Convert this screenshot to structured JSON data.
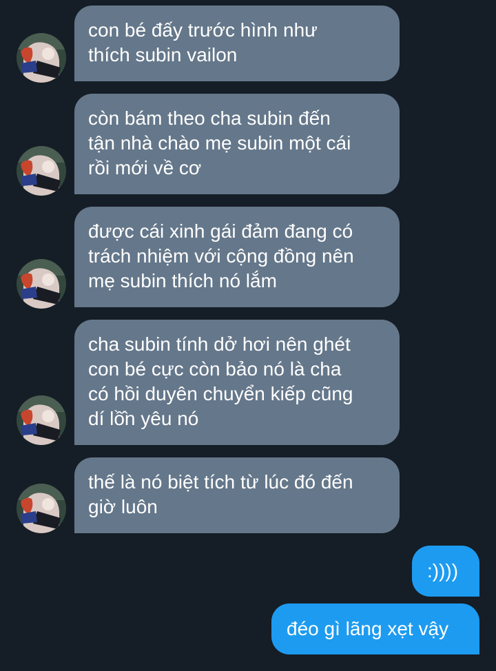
{
  "messages": [
    {
      "direction": "incoming",
      "lines": [
        "con bé đấy trước hình như",
        "thích subin vailon"
      ]
    },
    {
      "direction": "incoming",
      "lines": [
        "còn bám theo cha subin đến",
        "tận nhà chào mẹ subin một cái",
        "rồi mới về cơ"
      ]
    },
    {
      "direction": "incoming",
      "lines": [
        "được cái xinh gái đảm đang có",
        "trách nhiệm với cộng đồng nên",
        "mẹ subin thích nó lắm"
      ]
    },
    {
      "direction": "incoming",
      "lines": [
        "cha subin tính dở hơi nên ghét",
        "con bé cực còn bảo nó là cha",
        "có hồi duyên chuyển kiếp cũng",
        "dí lồ̂n yêu nó"
      ]
    },
    {
      "direction": "incoming",
      "lines": [
        "thế là nó biệt tích từ lúc đó đến",
        "giờ luôn"
      ]
    },
    {
      "direction": "outgoing",
      "lines": [
        ":))))"
      ]
    },
    {
      "direction": "outgoing",
      "lines": [
        "đéo gì lãng xẹt vậy"
      ]
    }
  ],
  "avatar_icon": "user-avatar-icon",
  "colors": {
    "background": "#151d26",
    "incoming_bubble": "#65778a",
    "outgoing_bubble": "#1d9bf0",
    "text": "#ffffff"
  }
}
